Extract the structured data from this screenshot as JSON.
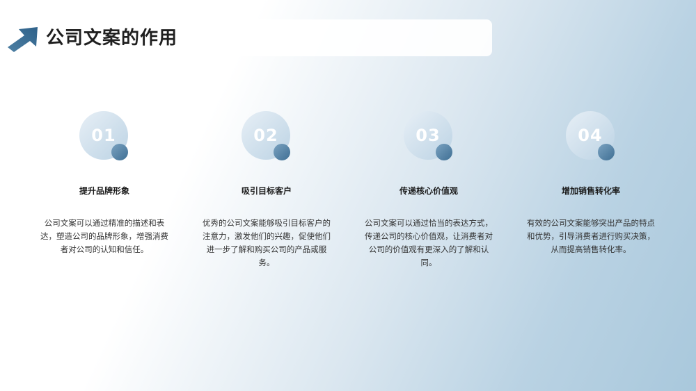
{
  "header": {
    "title": "公司文案的作用",
    "icon": "arrow-up-right-icon",
    "accent_color": "#3f6f94"
  },
  "cards": [
    {
      "number": "01",
      "title": "提升品牌形象",
      "description": "公司文案可以通过精准的描述和表达，塑造公司的品牌形象，增强消费者对公司的认知和信任。"
    },
    {
      "number": "02",
      "title": "吸引目标客户",
      "description": "优秀的公司文案能够吸引目标客户的注意力，激发他们的兴趣，促使他们进一步了解和购买公司的产品或服务。"
    },
    {
      "number": "03",
      "title": "传递核心价值观",
      "description": "公司文案可以通过恰当的表达方式，传递公司的核心价值观，让消费者对公司的价值观有更深入的了解和认同。"
    },
    {
      "number": "04",
      "title": "增加销售转化率",
      "description": "有效的公司文案能够突出产品的特点和优势，引导消费者进行购买决策，从而提高销售转化率。"
    }
  ]
}
